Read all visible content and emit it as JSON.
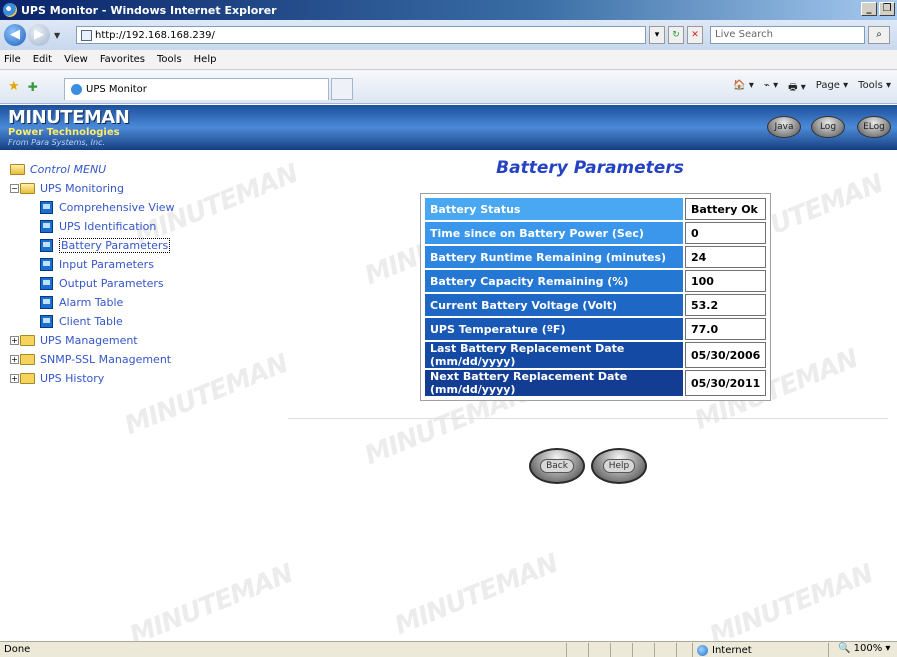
{
  "window": {
    "title": "UPS Monitor - Windows Internet Explorer",
    "controls": [
      "_",
      "❐"
    ]
  },
  "address_bar": {
    "url": "http://192.168.168.239/",
    "search_placeholder": "Live Search"
  },
  "menu_bar": {
    "items": [
      "File",
      "Edit",
      "View",
      "Favorites",
      "Tools",
      "Help"
    ]
  },
  "tabs": {
    "active_label": "UPS Monitor",
    "command_bar": [
      "🏠 ▾",
      "⌁ ▾",
      "🖶 ▾",
      "Page ▾",
      "Tools ▾"
    ]
  },
  "header": {
    "logo_line1": "MINUTEMAN",
    "logo_line2": "Power Technologies",
    "logo_line3": "From Para Systems, Inc.",
    "buttons": [
      "Java",
      "Log",
      "ELog"
    ]
  },
  "watermark_text": "MINUTEMAN",
  "tree": {
    "root": "Control MENU",
    "groups": [
      {
        "label": "UPS Monitoring",
        "expanded": true,
        "children": [
          "Comprehensive View",
          "UPS Identification",
          "Battery Parameters",
          "Input Parameters",
          "Output Parameters",
          "Alarm Table",
          "Client Table"
        ]
      },
      {
        "label": "UPS Management",
        "expanded": false
      },
      {
        "label": "SNMP-SSL Management",
        "expanded": false
      },
      {
        "label": "UPS History",
        "expanded": false
      }
    ],
    "selected": "Battery Parameters"
  },
  "page": {
    "title": "Battery Parameters",
    "rows": [
      {
        "label": "Battery Status",
        "value": "Battery Ok"
      },
      {
        "label": "Time since on Battery Power (Sec)",
        "value": "0"
      },
      {
        "label": "Battery Runtime Remaining (minutes)",
        "value": "24"
      },
      {
        "label": "Battery Capacity Remaining (%)",
        "value": "100"
      },
      {
        "label": "Current Battery Voltage (Volt)",
        "value": "53.2"
      },
      {
        "label": "UPS Temperature (ºF)",
        "value": "77.0"
      },
      {
        "label": "Last Battery Replacement Date (mm/dd/yyyy)",
        "value": "05/30/2006"
      },
      {
        "label": "Next Battery Replacement Date (mm/dd/yyyy)",
        "value": "05/30/2011"
      }
    ],
    "back_label": "Back",
    "help_label": "Help"
  },
  "status_bar": {
    "text": "Done",
    "zone": "Internet",
    "zoom": "100%"
  }
}
